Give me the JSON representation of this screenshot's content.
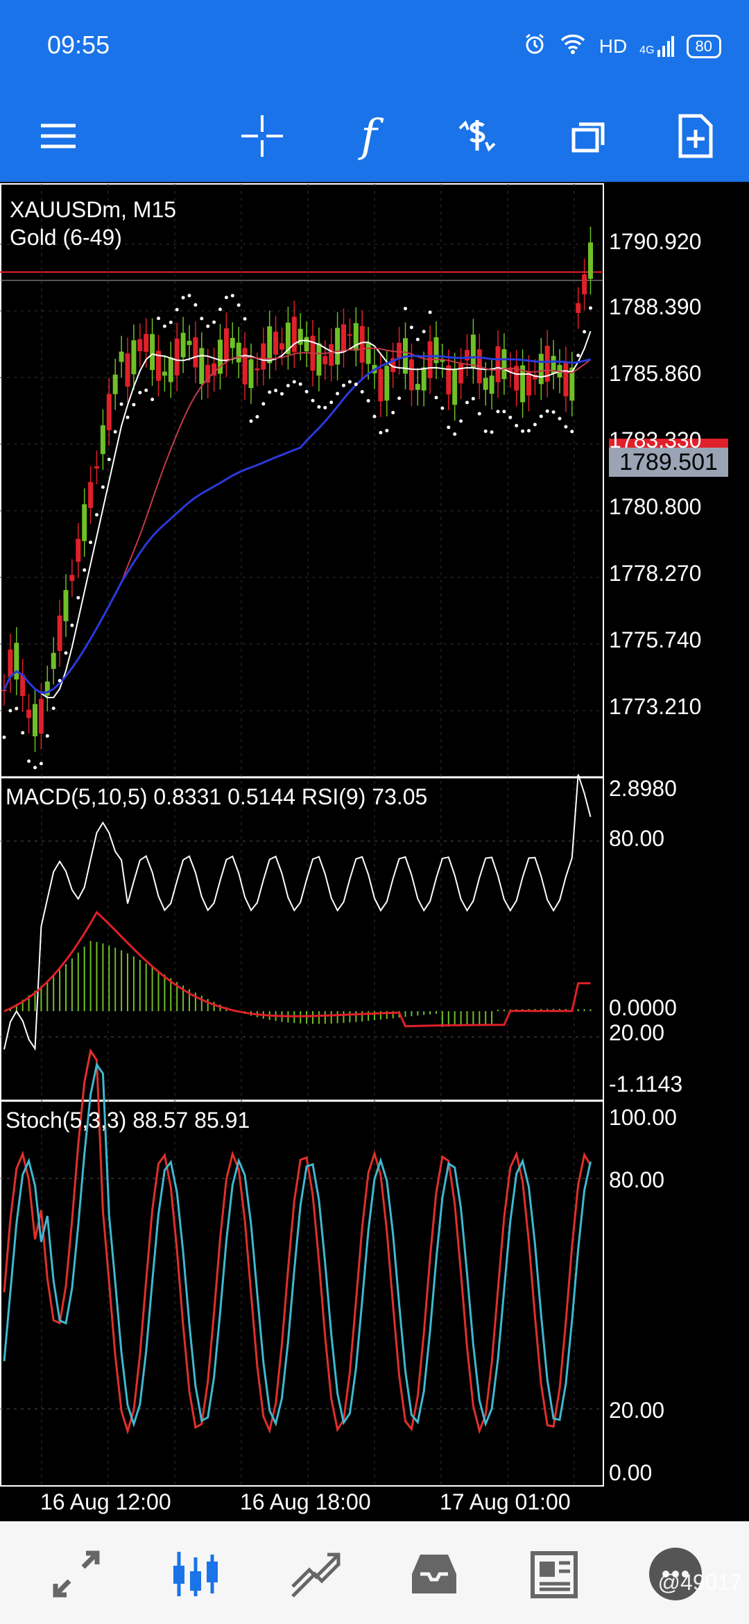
{
  "status_bar": {
    "time": "09:55",
    "icons": [
      "alarm-icon",
      "wifi-icon",
      "hd-icon",
      "signal-4g-icon"
    ],
    "hd_label": "HD",
    "network_label": "4G",
    "battery": "80"
  },
  "toolbar": {
    "buttons": [
      "menu-icon",
      "crosshair-icon",
      "function-icon",
      "dollar-trade-icon",
      "windows-icon",
      "new-order-icon"
    ],
    "function_symbol": "f"
  },
  "chart": {
    "symbol_line": "XAUUSDm, M15",
    "template_line": "Gold (6-49)",
    "current_price": "1789.501",
    "price_axis": [
      "1790.920",
      "1788.390",
      "1785.860",
      "1783.330",
      "1780.800",
      "1778.270",
      "1775.740",
      "1773.210"
    ],
    "macd_label": "MACD(5,10,5) 0.8331 0.5144 RSI(9) 73.05",
    "macd_axis": [
      "2.8980",
      "80.00",
      "0.0000",
      "20.00",
      "-1.1143"
    ],
    "stoch_label": "Stoch(5,3,3) 88.57 85.91",
    "stoch_axis": [
      "100.00",
      "80.00",
      "20.00",
      "0.00"
    ],
    "time_axis": [
      "16 Aug 12:00",
      "16 Aug 18:00",
      "17 Aug 01:00"
    ],
    "colors": {
      "bull": "#6fbf26",
      "bear": "#e0202a",
      "ma_fast": "#ffffff",
      "ma_mid": "#c23a4a",
      "ma_slow": "#2a3adb",
      "rsi": "#ffffff",
      "macd_signal": "#e0202a",
      "macd_hist": "#6fbf26",
      "stoch_main": "#e0302a",
      "stoch_signal": "#40b8d0"
    }
  },
  "bottom_nav": {
    "items": [
      "quotes-icon",
      "chart-icon",
      "trade-icon",
      "history-icon",
      "news-icon",
      "chat-icon"
    ],
    "active": "chart-icon"
  },
  "watermark": "@49017"
}
